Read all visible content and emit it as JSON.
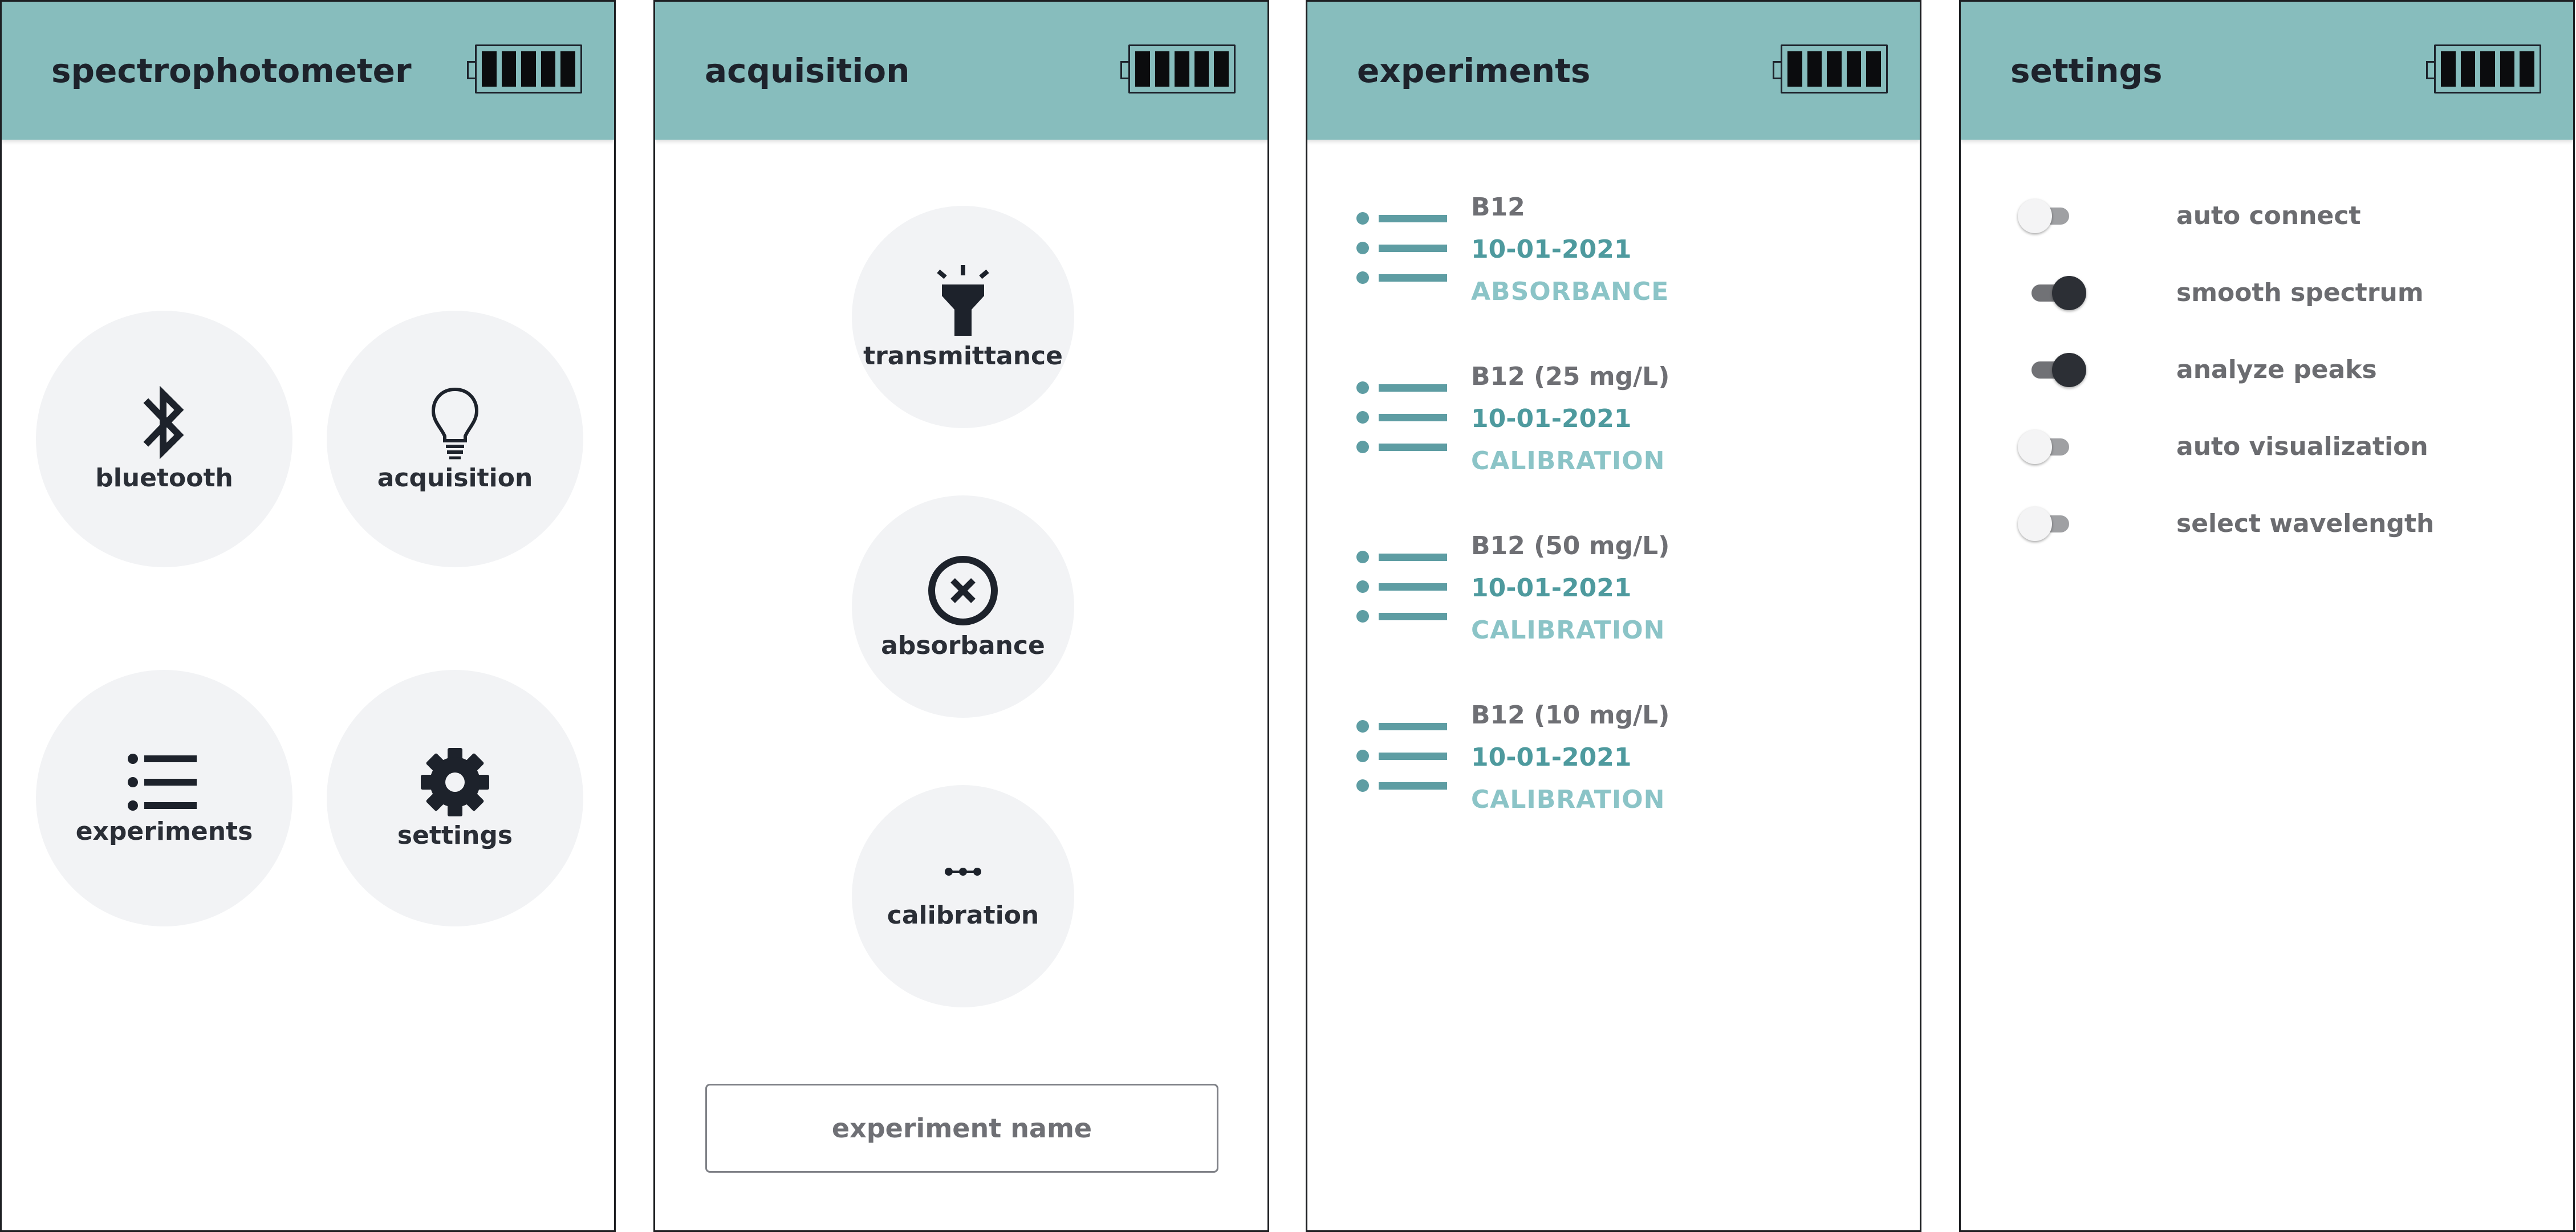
{
  "colors": {
    "header": "#87bdbd",
    "dark": "#1d222b",
    "circle_bg": "#f2f3f5",
    "teal_dark": "#4e9a9e",
    "teal_light": "#8bc4c7",
    "list_icon": "#5e9da3"
  },
  "home": {
    "title": "spectrophotometer",
    "tiles": [
      {
        "label": "bluetooth",
        "icon": "bluetooth-icon"
      },
      {
        "label": "acquisition",
        "icon": "lightbulb-icon"
      },
      {
        "label": "experiments",
        "icon": "list-icon"
      },
      {
        "label": "settings",
        "icon": "gear-icon"
      }
    ]
  },
  "acquisition": {
    "title": "acquisition",
    "modes": [
      {
        "label": "transmittance",
        "icon": "flashlight-icon"
      },
      {
        "label": "absorbance",
        "icon": "circle-x-icon"
      },
      {
        "label": "calibration",
        "icon": "dots-line-icon"
      }
    ],
    "experiment_name_placeholder": "experiment name"
  },
  "experiments": {
    "title": "experiments",
    "items": [
      {
        "name": "B12",
        "date": "10-01-2021",
        "type": "ABSORBANCE"
      },
      {
        "name": "B12 (25 mg/L)",
        "date": "10-01-2021",
        "type": "CALIBRATION"
      },
      {
        "name": "B12 (50 mg/L)",
        "date": "10-01-2021",
        "type": "CALIBRATION"
      },
      {
        "name": "B12 (10 mg/L)",
        "date": "10-01-2021",
        "type": "CALIBRATION"
      }
    ]
  },
  "settings": {
    "title": "settings",
    "items": [
      {
        "label": "auto connect",
        "on": false
      },
      {
        "label": "smooth spectrum",
        "on": true
      },
      {
        "label": "analyze peaks",
        "on": true
      },
      {
        "label": "auto visualization",
        "on": false
      },
      {
        "label": "select wavelength",
        "on": false
      }
    ]
  },
  "battery": {
    "icon": "battery-icon",
    "level": 1.0
  }
}
